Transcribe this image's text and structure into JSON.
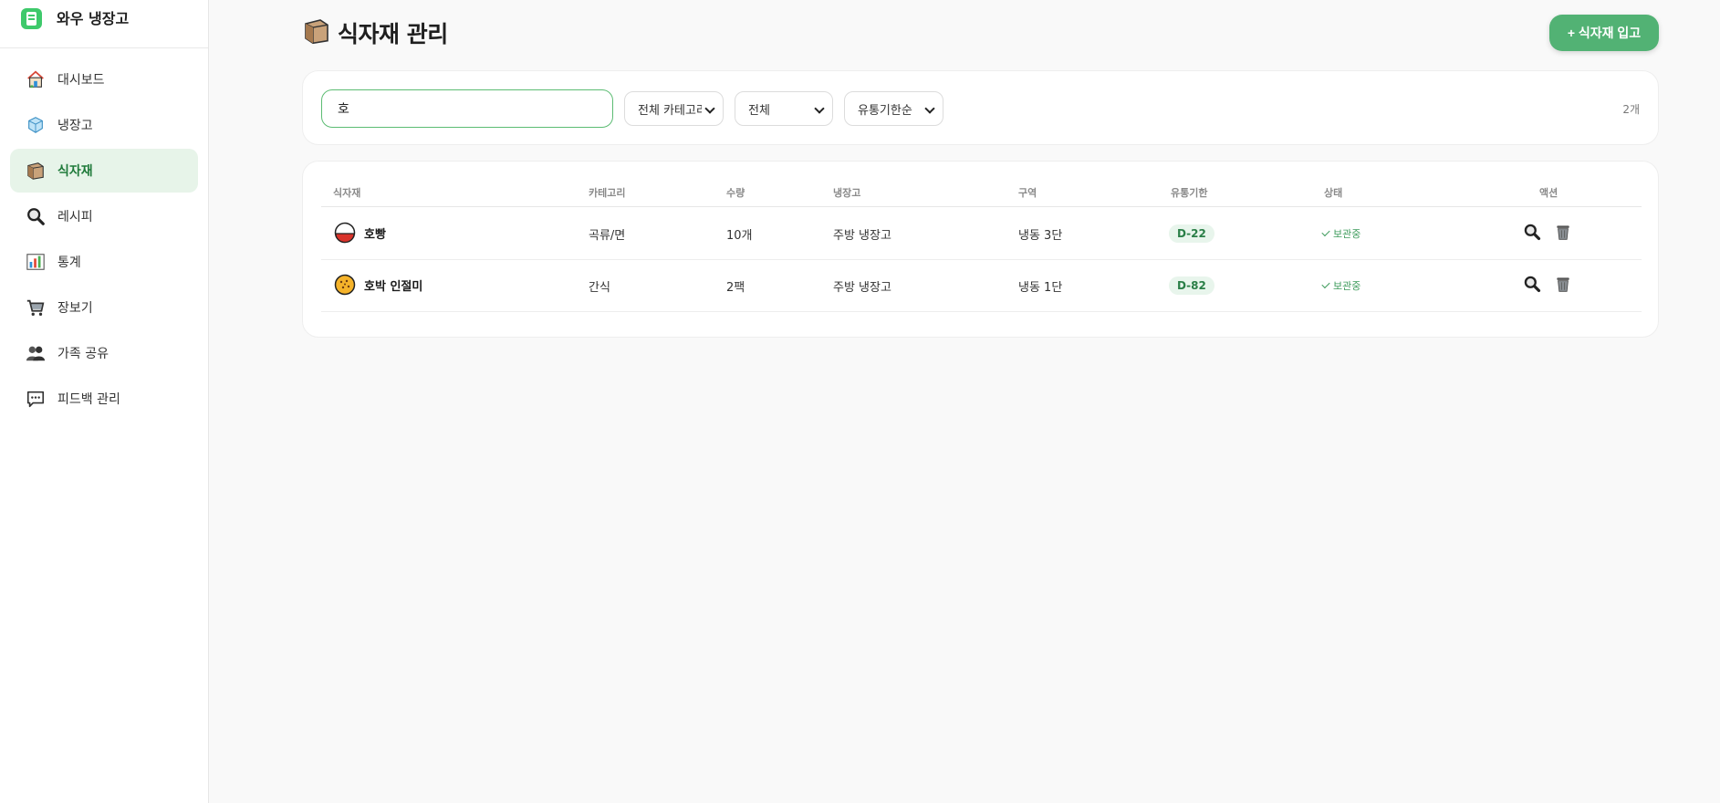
{
  "app": {
    "name": "와우 냉장고"
  },
  "sidebar": {
    "items": [
      {
        "label": "대시보드",
        "icon": "home-icon",
        "active": false
      },
      {
        "label": "냉장고",
        "icon": "ice-cube-icon",
        "active": false
      },
      {
        "label": "식자재",
        "icon": "box-icon",
        "active": true
      },
      {
        "label": "레시피",
        "icon": "magnifier-icon",
        "active": false
      },
      {
        "label": "통계",
        "icon": "bar-chart-icon",
        "active": false
      },
      {
        "label": "장보기",
        "icon": "cart-icon",
        "active": false
      },
      {
        "label": "가족 공유",
        "icon": "people-icon",
        "active": false
      },
      {
        "label": "피드백 관리",
        "icon": "speech-bubble-icon",
        "active": false
      }
    ]
  },
  "header": {
    "title": "식자재 관리",
    "add_button_label": "+ 식자재 입고"
  },
  "filters": {
    "search_value": "호",
    "category_select": "전체 카테고리",
    "status_select": "전체",
    "sort_select": "유통기한순",
    "result_count": "2개"
  },
  "table": {
    "columns": [
      "식자재",
      "카테고리",
      "수량",
      "냉장고",
      "구역",
      "유통기한",
      "상태",
      "액션"
    ],
    "rows": [
      {
        "name": "호빵",
        "icon": "bun-icon",
        "category": "곡류/면",
        "quantity": "10개",
        "fridge": "주방 냉장고",
        "zone": "냉동 3단",
        "expiry": "D-22",
        "status": "보관중"
      },
      {
        "name": "호박 인절미",
        "icon": "cookie-icon",
        "category": "간식",
        "quantity": "2팩",
        "fridge": "주방 냉장고",
        "zone": "냉동 1단",
        "expiry": "D-82",
        "status": "보관중"
      }
    ]
  },
  "colors": {
    "accent": "#52b274",
    "active_bg": "#e7f4e9",
    "status_green": "#3e9b5c",
    "dday_bg": "#e8f5ec"
  }
}
